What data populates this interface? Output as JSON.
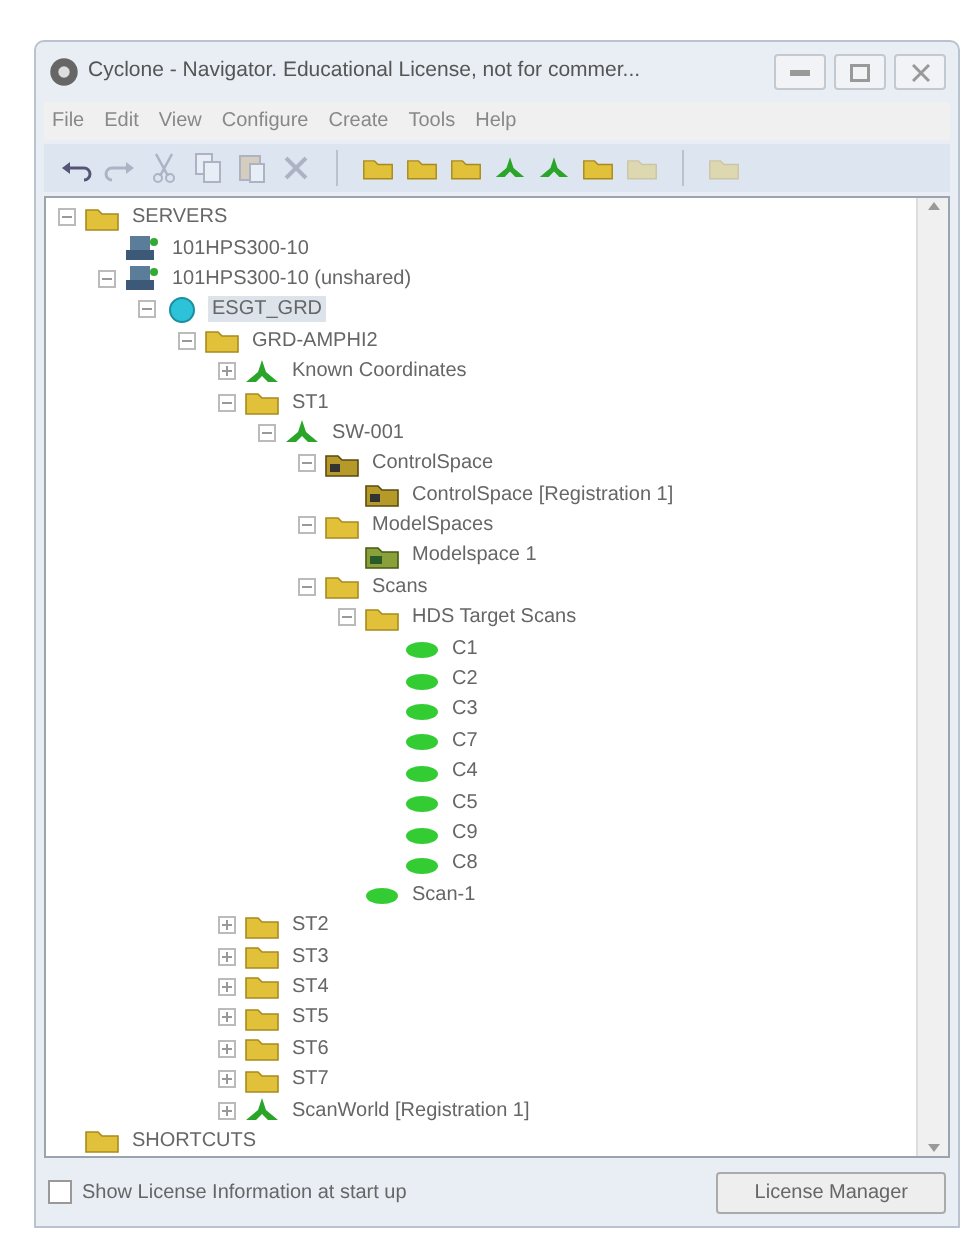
{
  "window": {
    "title": "Cyclone - Navigator. Educational License, not for commer..."
  },
  "menu": [
    "File",
    "Edit",
    "View",
    "Configure",
    "Create",
    "Tools",
    "Help"
  ],
  "toolbar": [
    {
      "kind": "undo",
      "disabled": false
    },
    {
      "kind": "redo",
      "disabled": true
    },
    {
      "kind": "cut",
      "disabled": true
    },
    {
      "kind": "copy",
      "disabled": true
    },
    {
      "kind": "paste",
      "disabled": true
    },
    {
      "kind": "delete",
      "disabled": true
    },
    {
      "kind": "sep"
    },
    {
      "kind": "folder",
      "disabled": false
    },
    {
      "kind": "folder",
      "disabled": false
    },
    {
      "kind": "folder",
      "disabled": false
    },
    {
      "kind": "scanworld",
      "disabled": false
    },
    {
      "kind": "scanworld",
      "disabled": false
    },
    {
      "kind": "folder",
      "disabled": false
    },
    {
      "kind": "folder",
      "disabled": true
    },
    {
      "kind": "sep"
    },
    {
      "kind": "folder",
      "disabled": true
    }
  ],
  "tree": [
    {
      "label": "SERVERS",
      "kind": "folder",
      "expanded": true,
      "selected": false,
      "children": [
        {
          "label": "101HPS300-10",
          "kind": "server",
          "selected": false
        },
        {
          "label": "101HPS300-10 (unshared)",
          "kind": "server",
          "expanded": true,
          "selected": false,
          "children": [
            {
              "label": "ESGT_GRD",
              "kind": "database",
              "expanded": true,
              "selected": true,
              "children": [
                {
                  "label": "GRD-AMPHI2",
                  "kind": "folder",
                  "expanded": true,
                  "selected": false,
                  "children": [
                    {
                      "label": "Known Coordinates",
                      "kind": "scanworld",
                      "expanded": false,
                      "selected": false
                    },
                    {
                      "label": "ST1",
                      "kind": "folder",
                      "expanded": true,
                      "selected": false,
                      "children": [
                        {
                          "label": "SW-001",
                          "kind": "scanworld",
                          "expanded": true,
                          "selected": false,
                          "children": [
                            {
                              "label": "ControlSpace",
                              "kind": "controlspace",
                              "expanded": true,
                              "selected": false,
                              "children": [
                                {
                                  "label": "ControlSpace [Registration 1]",
                                  "kind": "controlspace",
                                  "selected": false
                                }
                              ]
                            },
                            {
                              "label": "ModelSpaces",
                              "kind": "folder",
                              "expanded": true,
                              "selected": false,
                              "children": [
                                {
                                  "label": "Modelspace 1",
                                  "kind": "modelspace",
                                  "selected": false
                                }
                              ]
                            },
                            {
                              "label": "Scans",
                              "kind": "folder",
                              "expanded": true,
                              "selected": false,
                              "children": [
                                {
                                  "label": "HDS Target Scans",
                                  "kind": "folder",
                                  "expanded": true,
                                  "selected": false,
                                  "children": [
                                    {
                                      "label": "C1",
                                      "kind": "scan",
                                      "selected": false
                                    },
                                    {
                                      "label": "C2",
                                      "kind": "scan",
                                      "selected": false
                                    },
                                    {
                                      "label": "C3",
                                      "kind": "scan",
                                      "selected": false
                                    },
                                    {
                                      "label": "C7",
                                      "kind": "scan",
                                      "selected": false
                                    },
                                    {
                                      "label": "C4",
                                      "kind": "scan",
                                      "selected": false
                                    },
                                    {
                                      "label": "C5",
                                      "kind": "scan",
                                      "selected": false
                                    },
                                    {
                                      "label": "C9",
                                      "kind": "scan",
                                      "selected": false
                                    },
                                    {
                                      "label": "C8",
                                      "kind": "scan",
                                      "selected": false
                                    }
                                  ]
                                },
                                {
                                  "label": "Scan-1",
                                  "kind": "scan",
                                  "selected": false
                                }
                              ]
                            }
                          ]
                        }
                      ]
                    },
                    {
                      "label": "ST2",
                      "kind": "folder",
                      "expanded": false,
                      "selected": false
                    },
                    {
                      "label": "ST3",
                      "kind": "folder",
                      "expanded": false,
                      "selected": false
                    },
                    {
                      "label": "ST4",
                      "kind": "folder",
                      "expanded": false,
                      "selected": false
                    },
                    {
                      "label": "ST5",
                      "kind": "folder",
                      "expanded": false,
                      "selected": false
                    },
                    {
                      "label": "ST6",
                      "kind": "folder",
                      "expanded": false,
                      "selected": false
                    },
                    {
                      "label": "ST7",
                      "kind": "folder",
                      "expanded": false,
                      "selected": false
                    },
                    {
                      "label": "ScanWorld [Registration 1]",
                      "kind": "scanworld",
                      "expanded": false,
                      "selected": false
                    }
                  ]
                }
              ]
            }
          ]
        }
      ]
    },
    {
      "label": "SHORTCUTS",
      "kind": "folder",
      "selected": false
    }
  ],
  "footer": {
    "checkbox": {
      "label": "Show License Information at start up",
      "checked": false
    },
    "button": "License Manager"
  }
}
